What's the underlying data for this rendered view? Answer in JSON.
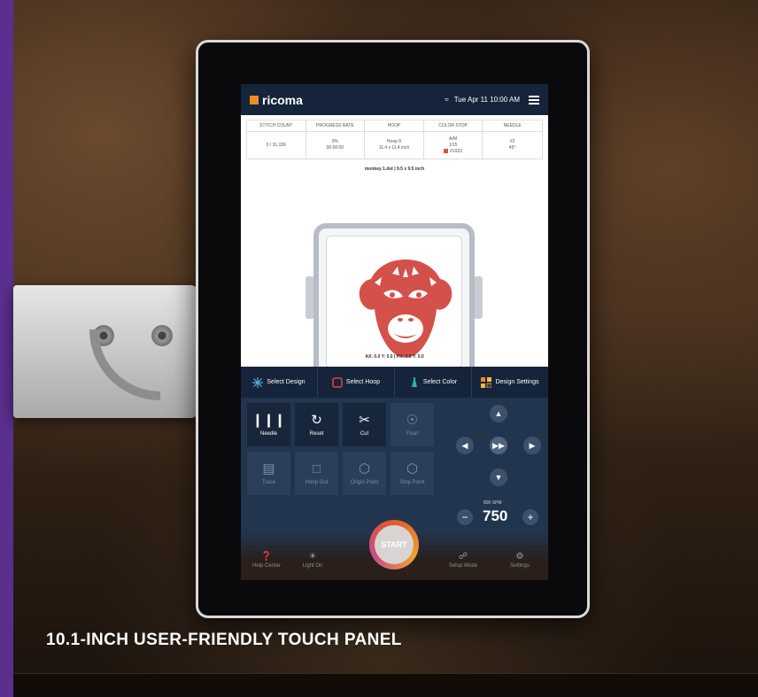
{
  "caption": "10.1-INCH USER-FRIENDLY TOUCH PANEL",
  "colors": {
    "accent": "#f08a24",
    "screen_bg": "#1b2b44",
    "monkey": "#d4504a"
  },
  "screen": {
    "logo": "ricoma",
    "datetime": "Tue Apr 11  10:00 AM",
    "stats": {
      "headers": [
        "STITCH COUNT",
        "PROGRESS RATE",
        "HOOP",
        "COLOR STOP",
        "NEEDLE"
      ],
      "stitch_count": "0 / 31,336",
      "progress_rate": "0%",
      "progress_time": "00:00:00",
      "hoop_name": "Hoop 8",
      "hoop_size": "11.4 x 11.4 inch",
      "color_stop_line1": "A/M",
      "color_stop_line2": "1/15",
      "color_code": "#1923",
      "needle_line1": "#2",
      "needle_line2": "45°"
    },
    "design_name": "monkey 1.dst  |  9.5 x 9.5 inch",
    "coords": "AX: 0.0  Y: 0.0   |   PX: 0.0  Y: 0.0",
    "tabs": [
      {
        "label": "Select Design",
        "icon": "design-icon"
      },
      {
        "label": "Select Hoop",
        "icon": "hoop-icon"
      },
      {
        "label": "Select Color",
        "icon": "color-icon"
      },
      {
        "label": "Design Settings",
        "icon": "settings-grid-icon"
      }
    ],
    "buttons": {
      "needle": "Needle",
      "reset": "Reset",
      "cut": "Cut",
      "float": "Float",
      "trace": "Trace",
      "hoop_out": "Hoop Out",
      "origin_point": "Origin Point",
      "stop_point": "Stop Point"
    },
    "spm_label": "800 SPM",
    "speed": "750",
    "start": "START",
    "footer": {
      "help_center": "Help Center",
      "light_on": "Light On",
      "setup_mode": "Setup Mode",
      "settings": "Settings"
    }
  }
}
